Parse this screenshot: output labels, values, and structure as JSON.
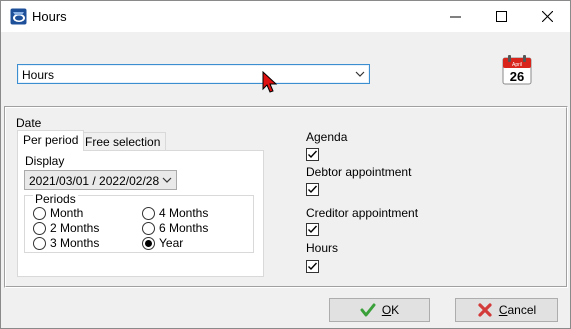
{
  "window": {
    "title": "Hours",
    "buttons": {
      "minimize": "minimize",
      "maximize": "maximize",
      "close": "close"
    }
  },
  "header": {
    "selected_item": "Hours",
    "calendar": {
      "month": "April",
      "day": "26"
    }
  },
  "date_section": {
    "label": "Date",
    "tabs": [
      {
        "label": "Per period",
        "active": true
      },
      {
        "label": "Free selection",
        "active": false
      }
    ],
    "display_label": "Display",
    "display_value": "2021/03/01 / 2022/02/28",
    "periods": {
      "label": "Periods",
      "options": [
        {
          "label": "Month",
          "selected": false
        },
        {
          "label": "2 Months",
          "selected": false
        },
        {
          "label": "3 Months",
          "selected": false
        },
        {
          "label": "4 Months",
          "selected": false
        },
        {
          "label": "6 Months",
          "selected": false
        },
        {
          "label": "Year",
          "selected": true
        }
      ]
    }
  },
  "options": [
    {
      "label": "Agenda",
      "checked": true
    },
    {
      "label": "Debtor appointment",
      "checked": true
    },
    {
      "label": "Creditor appointment",
      "checked": true
    },
    {
      "label": "Hours",
      "checked": true
    }
  ],
  "buttons": {
    "ok": {
      "underlined": "O",
      "rest": "K"
    },
    "cancel": {
      "underlined": "C",
      "rest": "ancel"
    }
  },
  "colors": {
    "ok_check": "#3aa03a",
    "cancel_x": "#d33a3a",
    "combo_border": "#3b8fd1",
    "calendar_red": "#d9241b"
  }
}
